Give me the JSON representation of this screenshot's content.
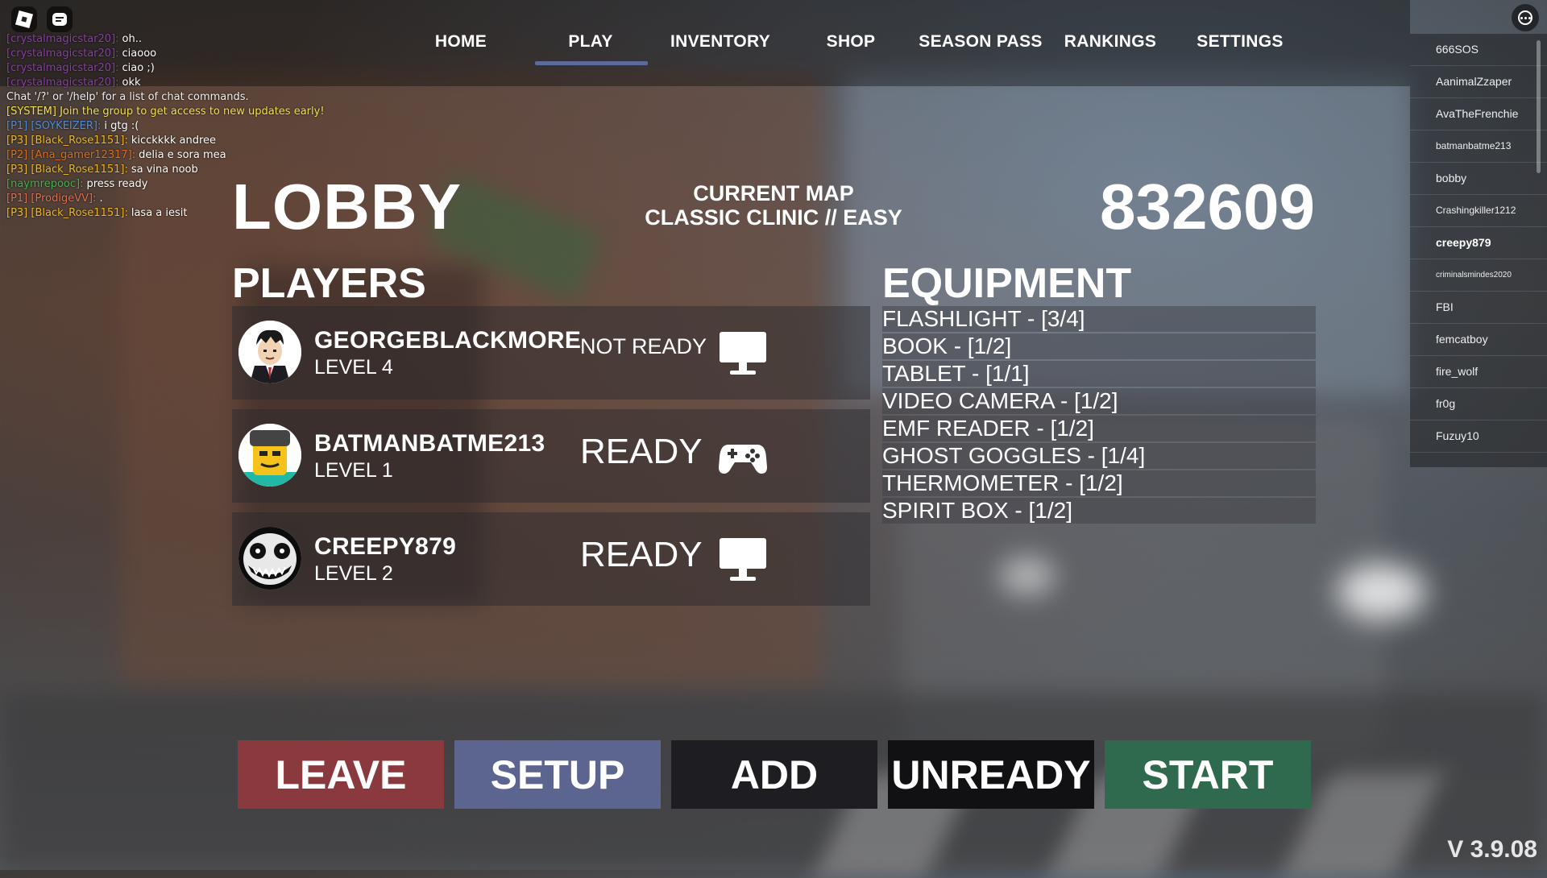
{
  "nav": {
    "items": [
      "HOME",
      "PLAY",
      "INVENTORY",
      "SHOP",
      "SEASON PASS",
      "RANKINGS",
      "SETTINGS"
    ],
    "active": "PLAY"
  },
  "chat": {
    "lines": [
      {
        "name": "[crystalmagicstar20]:",
        "text": "oh..",
        "color": "#8a3fa8"
      },
      {
        "name": "[crystalmagicstar20]:",
        "text": "ciaooo",
        "color": "#8a3fa8"
      },
      {
        "name": "[crystalmagicstar20]:",
        "text": "ciao ;)",
        "color": "#8a3fa8"
      },
      {
        "name": "[crystalmagicstar20]:",
        "text": "okk",
        "color": "#8a3fa8"
      },
      {
        "name": "",
        "text": "Chat '/?' or '/help' for a list of chat commands.",
        "color": "#ffffff",
        "textColor": "#f0f0f0"
      },
      {
        "name": "",
        "text": "[SYSTEM] Join the group to get access to new updates early!",
        "color": "#ffffff",
        "textColor": "#f5e04a"
      },
      {
        "name": "[P1] [SOYKEIZER]:",
        "text": "i gtg :(",
        "color": "#4f8fe0"
      },
      {
        "name": "[P3] [Black_Rose1151]:",
        "text": "kicckkkk andree",
        "color": "#f0b820"
      },
      {
        "name": "[P2] [Ana_gamer12317]:",
        "text": "delia e sora mea",
        "color": "#e07020"
      },
      {
        "name": "[P3] [Black_Rose1151]:",
        "text": "sa vina noob",
        "color": "#f0b820"
      },
      {
        "name": "[naymrepooc]:",
        "text": "press ready",
        "color": "#3fb84a"
      },
      {
        "name": "[P1] [ProdigeVV]:",
        "text": ".",
        "color": "#e07050"
      },
      {
        "name": "[P3] [Black_Rose1151]:",
        "text": "lasa a iesit",
        "color": "#f0b820"
      }
    ]
  },
  "lobby": {
    "title": "LOBBY",
    "current_map_label": "CURRENT MAP",
    "current_map": "CLASSIC CLINIC // EASY",
    "code": "832609",
    "players_label": "PLAYERS",
    "equipment_label": "EQUIPMENT"
  },
  "players": [
    {
      "name": "GEORGEBLACKMORE",
      "level": "LEVEL 4",
      "status": "NOT READY",
      "device": "monitor-icon"
    },
    {
      "name": "BATMANBATME213",
      "level": "LEVEL 1",
      "status": "READY",
      "device": "gamepad-icon"
    },
    {
      "name": "CREEPY879",
      "level": "LEVEL 2",
      "status": "READY",
      "device": "monitor-icon"
    }
  ],
  "equipment": [
    "FLASHLIGHT - [3/4]",
    "BOOK - [1/2]",
    "TABLET - [1/1]",
    "VIDEO CAMERA - [1/2]",
    "EMF READER - [1/2]",
    "GHOST GOGGLES - [1/4]",
    "THERMOMETER - [1/2]",
    "SPIRIT BOX - [1/2]"
  ],
  "buttons": {
    "leave": "LEAVE",
    "setup": "SETUP",
    "add": "ADD",
    "unready": "UNREADY",
    "start": "START"
  },
  "player_list": [
    "666SOS",
    "AanimalZzaper",
    "AvaTheFrenchie",
    "batmanbatme213",
    "bobby",
    "Crashingkiller1212",
    "creepy879",
    "criminalsmindes2020",
    "FBI",
    "femcatboy",
    "fire_wolf",
    "fr0g",
    "Fuzuy10"
  ],
  "version": "V 3.9.08",
  "colors": {
    "leave": "#8a3a3e",
    "setup": "#5c6490",
    "add": "#1e1e22",
    "unready": "#111114",
    "start": "#2f6a4e",
    "nav_underline": "#5c6b9c"
  }
}
